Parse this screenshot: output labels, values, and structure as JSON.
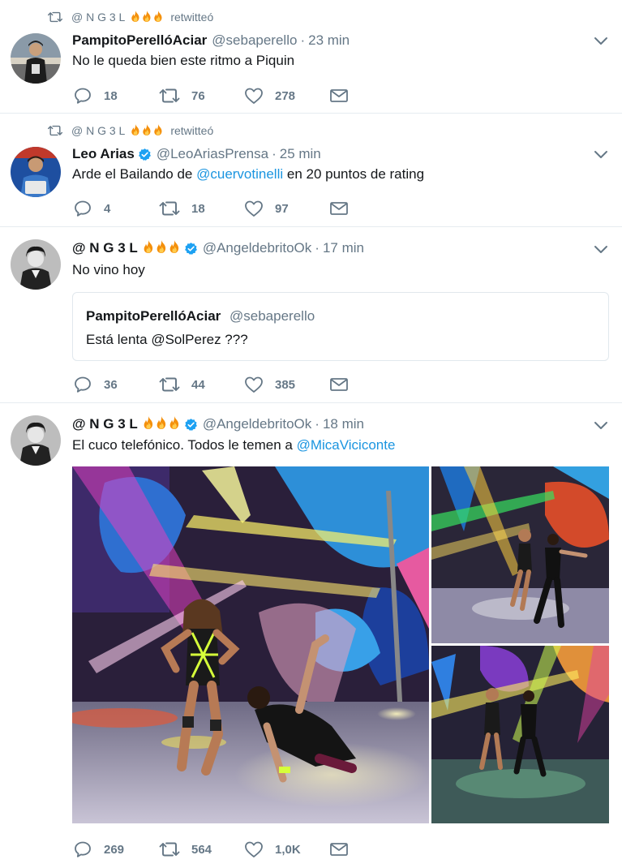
{
  "timeline": {
    "tweets": [
      {
        "retweeted_by": "@ N G 3 L",
        "retweet_label": "retwitteó",
        "author_name": "PampitoPerellóAciar",
        "author_handle": "@sebaperello",
        "time": "23 min",
        "text": "No le queda bien este ritmo a Piquin",
        "replies": "18",
        "retweets": "76",
        "likes": "278"
      },
      {
        "retweeted_by": "@ N G 3 L",
        "retweet_label": "retwitteó",
        "author_name": "Leo Arias",
        "author_handle": "@LeoAriasPrensa",
        "time": "25 min",
        "text_before": "Arde el Bailando de ",
        "text_mention": "@cuervotinelli",
        "text_after": " en 20 puntos de rating",
        "replies": "4",
        "retweets": "18",
        "likes": "97"
      },
      {
        "author_name": "@ N G 3 L",
        "author_handle": "@AngeldebritoOk",
        "time": "17 min",
        "text": "No vino hoy",
        "quoted": {
          "author_name": "PampitoPerellóAciar",
          "author_handle": "@sebaperello",
          "text": "Está lenta @SolPerez ???"
        },
        "replies": "36",
        "retweets": "44",
        "likes": "385"
      },
      {
        "author_name": "@ N G 3 L",
        "author_handle": "@AngeldebritoOk",
        "time": "18 min",
        "text_before": "El cuco telefónico. Todos le temen a ",
        "text_mention": "@MicaViciconte",
        "replies": "269",
        "retweets": "564",
        "likes": "1,0K"
      }
    ]
  },
  "separator": "·",
  "colors": {
    "text": "#14171a",
    "secondary": "#657786",
    "link": "#1b95e0",
    "verified": "#1da1f2",
    "border": "#e6ecf0"
  },
  "icons": [
    "retweet-icon",
    "fire-emoji",
    "verified-badge-icon",
    "chevron-down-icon",
    "reply-icon",
    "like-icon",
    "direct-message-icon"
  ]
}
